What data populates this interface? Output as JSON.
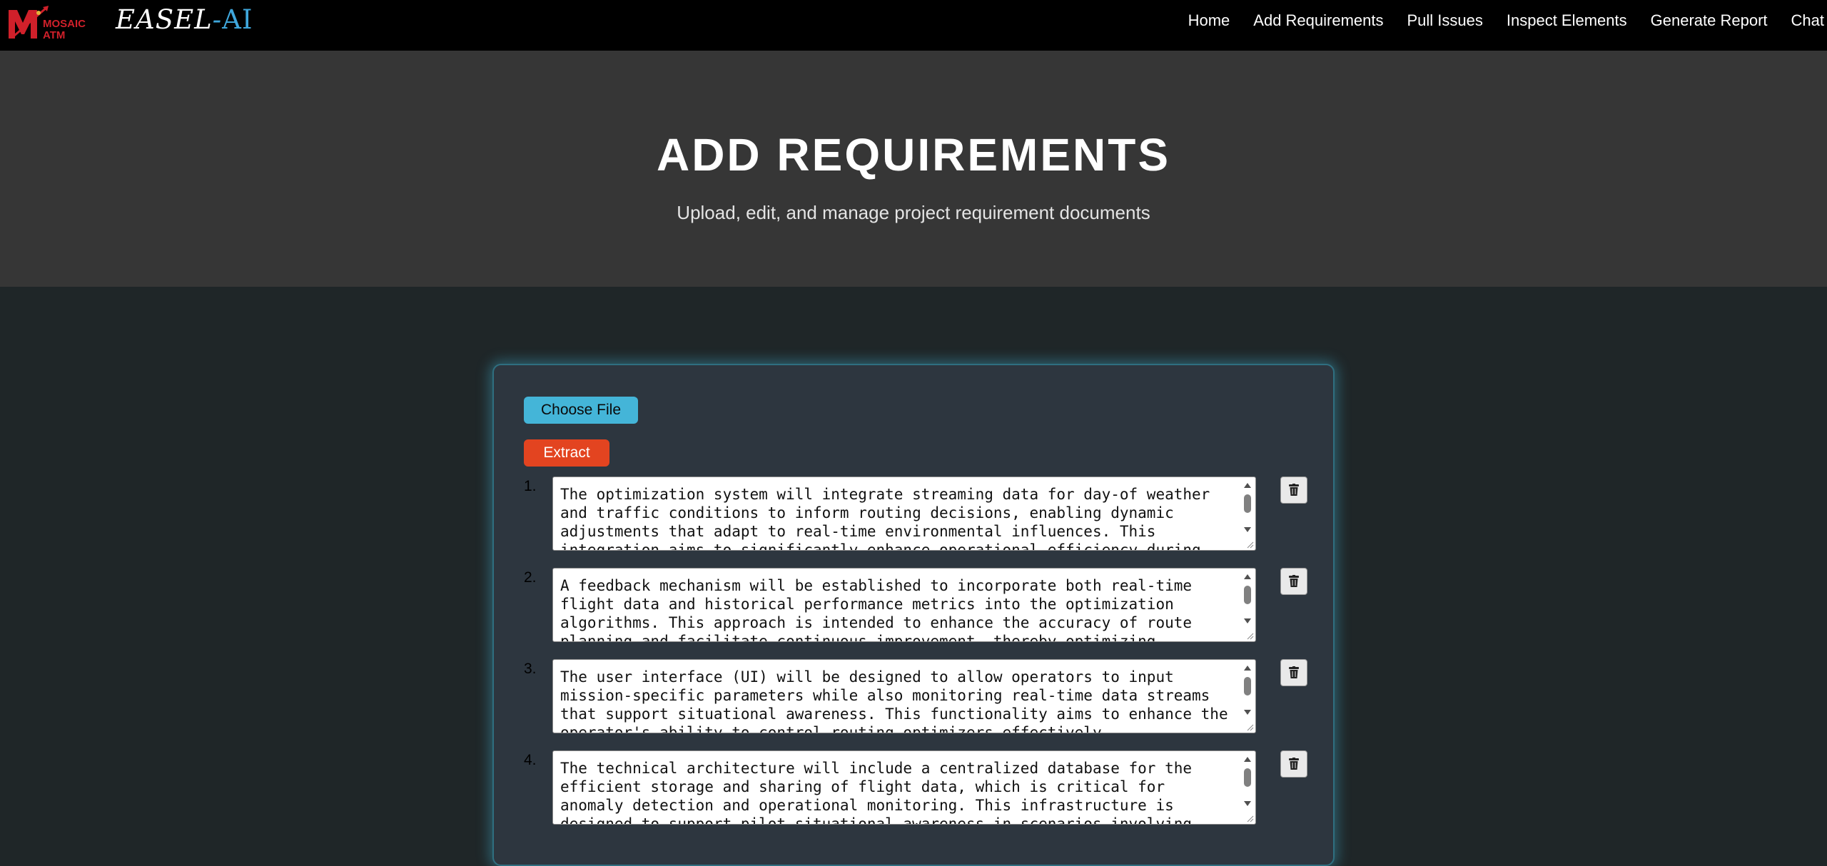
{
  "brand": {
    "logo_text_top": "MOSAIC",
    "logo_text_bottom": "ATM",
    "name_prefix": "EASEL",
    "name_dash": "-",
    "name_suffix": "AI",
    "icon": "mosaic-atm-logo"
  },
  "nav": {
    "items": [
      {
        "label": "Home"
      },
      {
        "label": "Add Requirements"
      },
      {
        "label": "Pull Issues"
      },
      {
        "label": "Inspect Elements"
      },
      {
        "label": "Generate Report"
      },
      {
        "label": "Chat"
      }
    ]
  },
  "hero": {
    "title": "ADD REQUIREMENTS",
    "subtitle": "Upload, edit, and manage project requirement documents"
  },
  "actions": {
    "choose_file": "Choose File",
    "extract": "Extract"
  },
  "requirements": [
    {
      "number": "1.",
      "text": "The optimization system will integrate streaming data for day-of weather and traffic conditions to inform routing decisions, enabling dynamic adjustments that adapt to real-time environmental influences. This integration aims to significantly enhance operational efficiency during"
    },
    {
      "number": "2.",
      "text": "A feedback mechanism will be established to incorporate both real-time flight data and historical performance metrics into the optimization algorithms. This approach is intended to enhance the accuracy of route planning and facilitate continuous improvement, thereby optimizing"
    },
    {
      "number": "3.",
      "text": "The user interface (UI) will be designed to allow operators to input mission-specific parameters while also monitoring real-time data streams that support situational awareness. This functionality aims to enhance the operator's ability to control routing optimizers effectively."
    },
    {
      "number": "4.",
      "text": "The technical architecture will include a centralized database for the efficient storage and sharing of flight data, which is critical for anomaly detection and operational monitoring. This infrastructure is designed to support pilot situational awareness in scenarios involving"
    }
  ],
  "icons": {
    "delete": "trash-icon",
    "scroll_up": "arrow-up-icon",
    "scroll_down": "arrow-down-icon",
    "resize": "resize-grip-icon"
  },
  "colors": {
    "navbar_bg": "#000000",
    "hero_bg": "#363636",
    "page_bg": "#1f2628",
    "panel_bg": "#2d363f",
    "panel_glow": "#40aac8",
    "choose_button": "#44b5d8",
    "extract_button": "#e34420",
    "brand_accent": "#3fa7dc",
    "logo_red": "#d0202a"
  }
}
